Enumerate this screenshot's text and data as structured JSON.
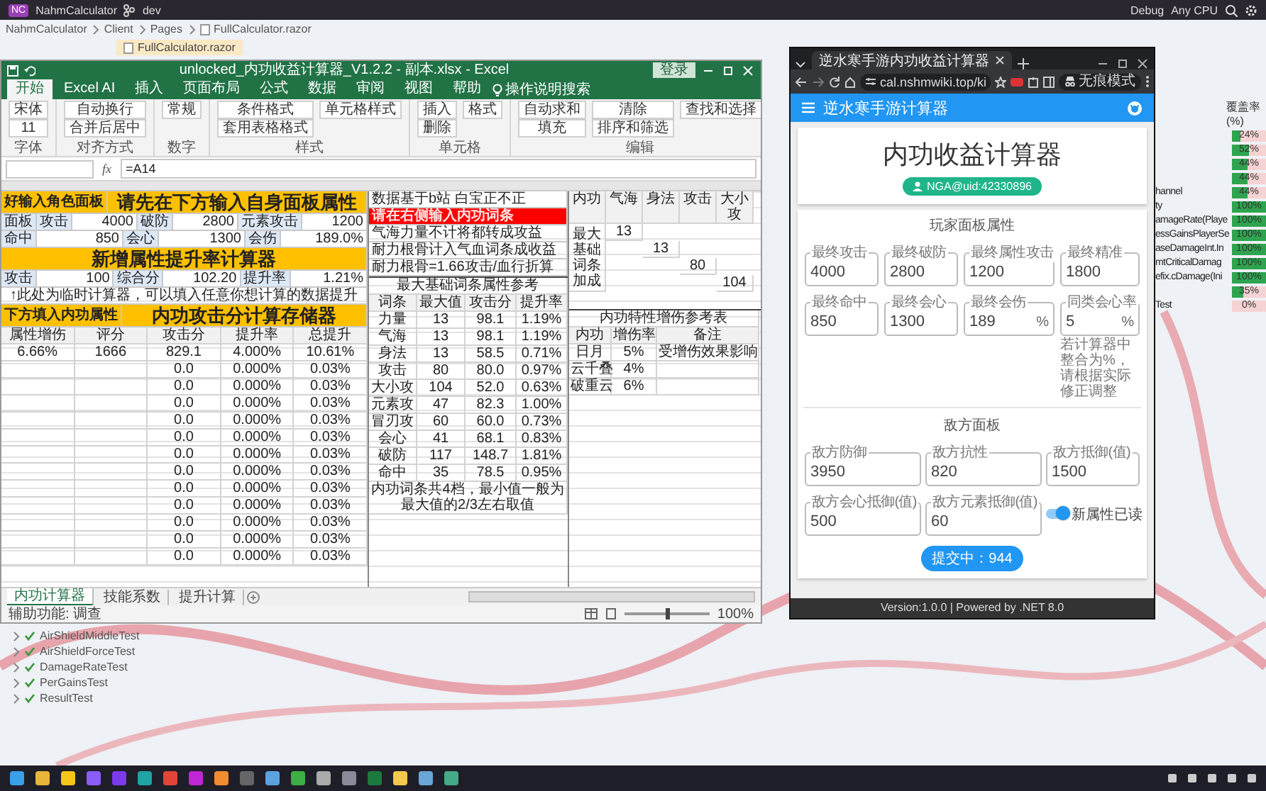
{
  "ide": {
    "badge": "NC",
    "project": "NahmCalculator",
    "branch": "dev",
    "config": "Debug",
    "platform": "Any CPU",
    "breadcrumb": [
      "NahmCalculator",
      "Client",
      "Pages",
      "FullCalculator.razor"
    ],
    "file_tab": "FullCalculator.razor"
  },
  "excel": {
    "title": "unlocked_内功收益计算器_V1.2.2 - 副本.xlsx - Excel",
    "sign_in": "登录",
    "tabs": [
      {
        "label": "开始",
        "selected": true
      },
      {
        "label": "Excel AI",
        "selected": false
      },
      {
        "label": "插入",
        "selected": false
      },
      {
        "label": "页面布局",
        "selected": false
      },
      {
        "label": "公式",
        "selected": false
      },
      {
        "label": "数据",
        "selected": false
      },
      {
        "label": "审阅",
        "selected": false
      },
      {
        "label": "视图",
        "selected": false
      },
      {
        "label": "帮助",
        "selected": false
      }
    ],
    "search": "操作说明搜索",
    "ribbon": [
      {
        "label": "字体",
        "items": [
          "宋体",
          "11"
        ]
      },
      {
        "label": "对齐方式",
        "items": [
          "自动换行",
          "合并后居中"
        ]
      },
      {
        "label": "数字",
        "items": [
          "常规"
        ]
      },
      {
        "label": "样式",
        "items": [
          "条件格式",
          "套用表格格式",
          "单元格样式"
        ]
      },
      {
        "label": "单元格",
        "items": [
          "插入",
          "删除",
          "格式"
        ]
      },
      {
        "label": "编辑",
        "items": [
          "自动求和",
          "填充",
          "清除",
          "排序和筛选",
          "查找和选择"
        ]
      }
    ],
    "fx": "fx",
    "formula": "=A14",
    "left_rows": [
      [
        {
          "kind": "label",
          "text": "好输入角色面板"
        },
        {
          "kind": "title",
          "text": "请先在下方输入自身面板属性"
        }
      ],
      [
        {
          "kind": "head",
          "text": "面板"
        },
        {
          "kind": "head",
          "text": "攻击"
        },
        {
          "kind": "value",
          "text": "4000"
        },
        {
          "kind": "head",
          "text": "破防"
        },
        {
          "kind": "value",
          "text": "2800"
        },
        {
          "kind": "head",
          "text": "元素攻击"
        },
        {
          "kind": "value",
          "text": "1200"
        }
      ],
      [
        {
          "kind": "head",
          "text": "命中"
        },
        {
          "kind": "value",
          "text": "850"
        },
        {
          "kind": "head",
          "text": "会心"
        },
        {
          "kind": "value",
          "text": "1300"
        },
        {
          "kind": "head",
          "text": "会伤"
        },
        {
          "kind": "value",
          "text": "189.0%"
        }
      ],
      [
        {
          "kind": "title",
          "text": "新增属性提升率计算器"
        }
      ],
      [
        {
          "kind": "head",
          "text": "攻击"
        },
        {
          "kind": "value",
          "text": "100"
        },
        {
          "kind": "head",
          "text": "综合分"
        },
        {
          "kind": "value",
          "text": "102.20"
        },
        {
          "kind": "head",
          "text": "提升率"
        },
        {
          "kind": "value",
          "text": "1.21%"
        }
      ],
      [
        {
          "kind": "note",
          "text": "↑此处为临时计算器，可以填入任意你想计算的数据提升"
        }
      ],
      [
        {
          "kind": "label",
          "text": "下方填入内功属性"
        },
        {
          "kind": "title",
          "text": "内功攻击分计算存储器"
        }
      ]
    ],
    "store_table": {
      "columns": [
        "属性增伤",
        "评分",
        "攻击分",
        "提升率",
        "总提升"
      ],
      "rows": [
        [
          "6.66%",
          "1666",
          "829.1",
          "4.000%",
          "10.61%"
        ],
        [
          null,
          null,
          "0.0",
          "0.000%",
          "0.03%"
        ],
        [
          null,
          null,
          "0.0",
          "0.000%",
          "0.03%"
        ],
        [
          null,
          null,
          "0.0",
          "0.000%",
          "0.03%"
        ],
        [
          null,
          null,
          "0.0",
          "0.000%",
          "0.03%"
        ],
        [
          null,
          null,
          "0.0",
          "0.000%",
          "0.03%"
        ],
        [
          null,
          null,
          "0.0",
          "0.000%",
          "0.03%"
        ],
        [
          null,
          null,
          "0.0",
          "0.000%",
          "0.03%"
        ],
        [
          null,
          null,
          "0.0",
          "0.000%",
          "0.03%"
        ],
        [
          null,
          null,
          "0.0",
          "0.000%",
          "0.03%"
        ],
        [
          null,
          null,
          "0.0",
          "0.000%",
          "0.03%"
        ],
        [
          null,
          null,
          "0.0",
          "0.000%",
          "0.03%"
        ],
        [
          null,
          null,
          "0.0",
          "0.000%",
          "0.03%"
        ]
      ]
    },
    "mid_rows": [
      [
        {
          "kind": "head",
          "text": "数据基于b站 白宝正不正"
        }
      ],
      [
        {
          "kind": "alert",
          "text": "请在右侧输入内功词条"
        }
      ],
      [
        {
          "kind": "plain",
          "text": "气海力量不计将都转成攻益"
        }
      ],
      [
        {
          "kind": "plain",
          "text": "耐力根骨计入气血词条成收益"
        }
      ],
      [
        {
          "kind": "plain",
          "text": "耐力根骨=1.66攻击/血行折算"
        }
      ]
    ],
    "ref_table": {
      "title": "最大基础词条属性参考",
      "columns": [
        "词条",
        "最大值",
        "攻击分",
        "提升率"
      ],
      "rows": [
        [
          "力量",
          "13",
          "98.1",
          "1.19%"
        ],
        [
          "气海",
          "13",
          "98.1",
          "1.19%"
        ],
        [
          "身法",
          "13",
          "58.5",
          "0.71%"
        ],
        [
          "攻击",
          "80",
          "80.0",
          "0.97%"
        ],
        [
          "大小攻",
          "104",
          "52.0",
          "0.63%"
        ],
        [
          "元素攻",
          "47",
          "82.3",
          "1.00%"
        ],
        [
          "冒刃攻",
          "60",
          "60.0",
          "0.73%"
        ],
        [
          "会心",
          "41",
          "68.1",
          "0.83%"
        ],
        [
          "破防",
          "117",
          "148.7",
          "1.81%"
        ],
        [
          "命中",
          "35",
          "78.5",
          "0.95%"
        ]
      ],
      "note": "内功词条共4档，最小值一般为最大值的2/3左右取值"
    },
    "bonus_table": {
      "title": "内功特性增伤参考表",
      "columns": [
        "内功",
        "增伤率",
        "备注"
      ],
      "rows": [
        [
          "日月",
          "5%",
          "受增伤效果影响"
        ],
        [
          "云千叠",
          "4%",
          null
        ],
        [
          "破重云",
          "6%",
          null
        ]
      ]
    },
    "attr_table": {
      "columns": [
        "内功",
        "气海",
        "身法",
        "攻击",
        "大小攻"
      ],
      "label": "最大基础词条加成",
      "values": [
        "13",
        "13",
        "80",
        "104"
      ]
    },
    "sheets": [
      {
        "label": "内功计算器",
        "selected": true
      },
      {
        "label": "技能系数",
        "selected": false
      },
      {
        "label": "提升计算",
        "selected": false
      }
    ],
    "status": "辅助功能: 调查",
    "zoom_slider": {
      "level": 0.5
    },
    "zoom": "100%"
  },
  "browser": {
    "tab": "逆水寒手游内功收益计算器",
    "url": "cal.nshmwiki.top/ki",
    "incognito": "无痕模式",
    "app_title": "逆水寒手游计算器",
    "heading": "内功收益计算器",
    "author": "NGA@uid:42330896",
    "player_section": "玩家面板属性",
    "player_fields": [
      {
        "label": "最终攻击",
        "value": "4000"
      },
      {
        "label": "最终破防",
        "value": "2800"
      },
      {
        "label": "最终属性攻击",
        "value": "1200"
      },
      {
        "label": "最终精准",
        "value": "1800"
      },
      {
        "label": "最终命中",
        "value": "850"
      },
      {
        "label": "最终会心",
        "value": "1300"
      },
      {
        "label": "最终会伤",
        "value": "189",
        "suffix": "%"
      },
      {
        "label": "同类会心率",
        "value": "5",
        "suffix": "%"
      }
    ],
    "hint": "若计算器中整合为%，请根据实际修正调整",
    "enemy_section": "敌方面板",
    "enemy_fields": [
      {
        "label": "敌方防御",
        "value": "3950"
      },
      {
        "label": "敌方抗性",
        "value": "820"
      },
      {
        "label": "敌方抵御(值)",
        "value": "1500"
      },
      {
        "label": "敌方会心抵御(值)",
        "value": "500"
      },
      {
        "label": "敌方元素抵御(值)",
        "value": "60"
      }
    ],
    "toggle": {
      "label": "新属性已读",
      "on": true
    },
    "result": "提交中：944",
    "footer": "Version:1.0.0 | Powered by .NET 8.0"
  },
  "coverage": {
    "header": "覆盖率 (%)",
    "rows": [
      {
        "level": 0.24,
        "reading": "24%"
      },
      {
        "level": 0.52,
        "reading": "52%"
      },
      {
        "level": 0.44,
        "reading": "44%"
      },
      {
        "level": 0.44,
        "reading": "44%"
      },
      {
        "label": "hannel",
        "level": 0.44,
        "reading": "44%"
      },
      {
        "label": "ty",
        "level": 1,
        "reading": "100%"
      },
      {
        "label": "amageRate(Playe",
        "level": 1,
        "reading": "100%"
      },
      {
        "label": "essGainsPlayerSe",
        "level": 1,
        "reading": "100%"
      },
      {
        "label": "aseDamageInt.In",
        "level": 1,
        "reading": "100%"
      },
      {
        "label": "mtCriticalDamag",
        "level": 1,
        "reading": "100%"
      },
      {
        "label": "efix.cDamage(Ini",
        "level": 1,
        "reading": "100%"
      },
      {
        "level": 0.35,
        "reading": "35%"
      },
      {
        "label": "Test",
        "level": 0,
        "reading": "0%"
      }
    ]
  },
  "tests": [
    {
      "name": "AirShieldMiddleTest",
      "passed": true
    },
    {
      "name": "AirShieldForceTest",
      "passed": true
    },
    {
      "name": "DamageRateTest",
      "passed": true
    },
    {
      "name": "PerGainsTest",
      "passed": true
    },
    {
      "name": "ResultTest",
      "passed": true
    }
  ]
}
